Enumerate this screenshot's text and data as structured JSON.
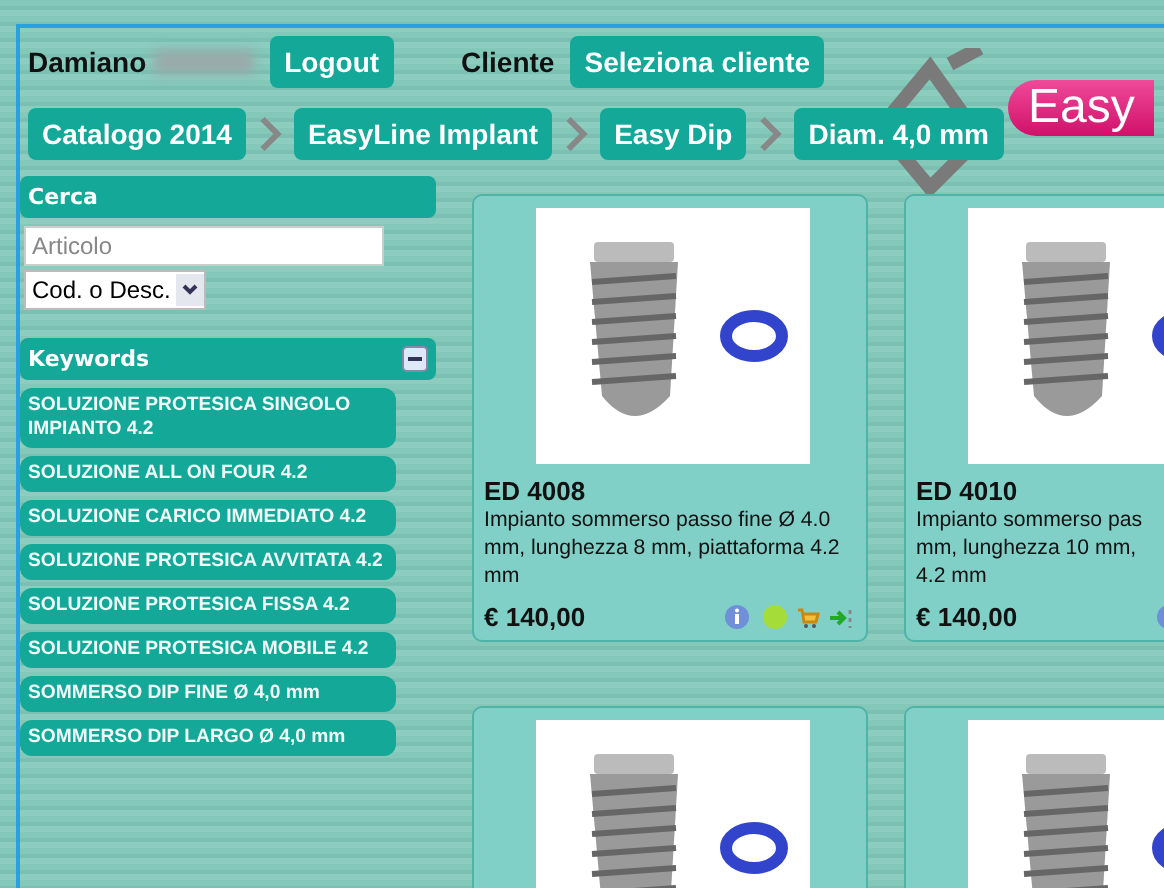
{
  "header": {
    "user": "Damiano",
    "logout": "Logout",
    "client_label": "Cliente",
    "client_button": "Seleziona cliente"
  },
  "breadcrumb": [
    "Catalogo 2014",
    "EasyLine Implant",
    "Easy Dip",
    "Diam. 4,0 mm"
  ],
  "logo": "Easy",
  "search": {
    "title": "Cerca",
    "placeholder": "Articolo",
    "mode": "Cod. o Desc."
  },
  "keywords": {
    "title": "Keywords",
    "expanded": true,
    "items": [
      "SOLUZIONE PROTESICA SINGOLO IMPIANTO 4.2",
      "SOLUZIONE ALL ON FOUR 4.2",
      "SOLUZIONE CARICO IMMEDIATO 4.2",
      "SOLUZIONE PROTESICA AVVITATA 4.2",
      "SOLUZIONE PROTESICA FISSA 4.2",
      "SOLUZIONE PROTESICA MOBILE 4.2",
      "SOMMERSO DIP FINE Ø 4,0 mm",
      "SOMMERSO DIP LARGO Ø 4,0 mm"
    ]
  },
  "products": [
    {
      "kind": "full",
      "code": "ED 4008",
      "description": [
        "Impianto sommerso passo fine Ø 4.0",
        "mm, lunghezza 8 mm, piattaforma 4.2",
        "mm"
      ],
      "price": "€ 140,00"
    },
    {
      "kind": "full",
      "code": "ED 4010",
      "description": [
        "Impianto sommerso pas",
        "mm, lunghezza 10 mm,",
        "4.2 mm"
      ],
      "price": "€ 140,00"
    },
    {
      "kind": "image_only"
    },
    {
      "kind": "image_only"
    }
  ]
}
